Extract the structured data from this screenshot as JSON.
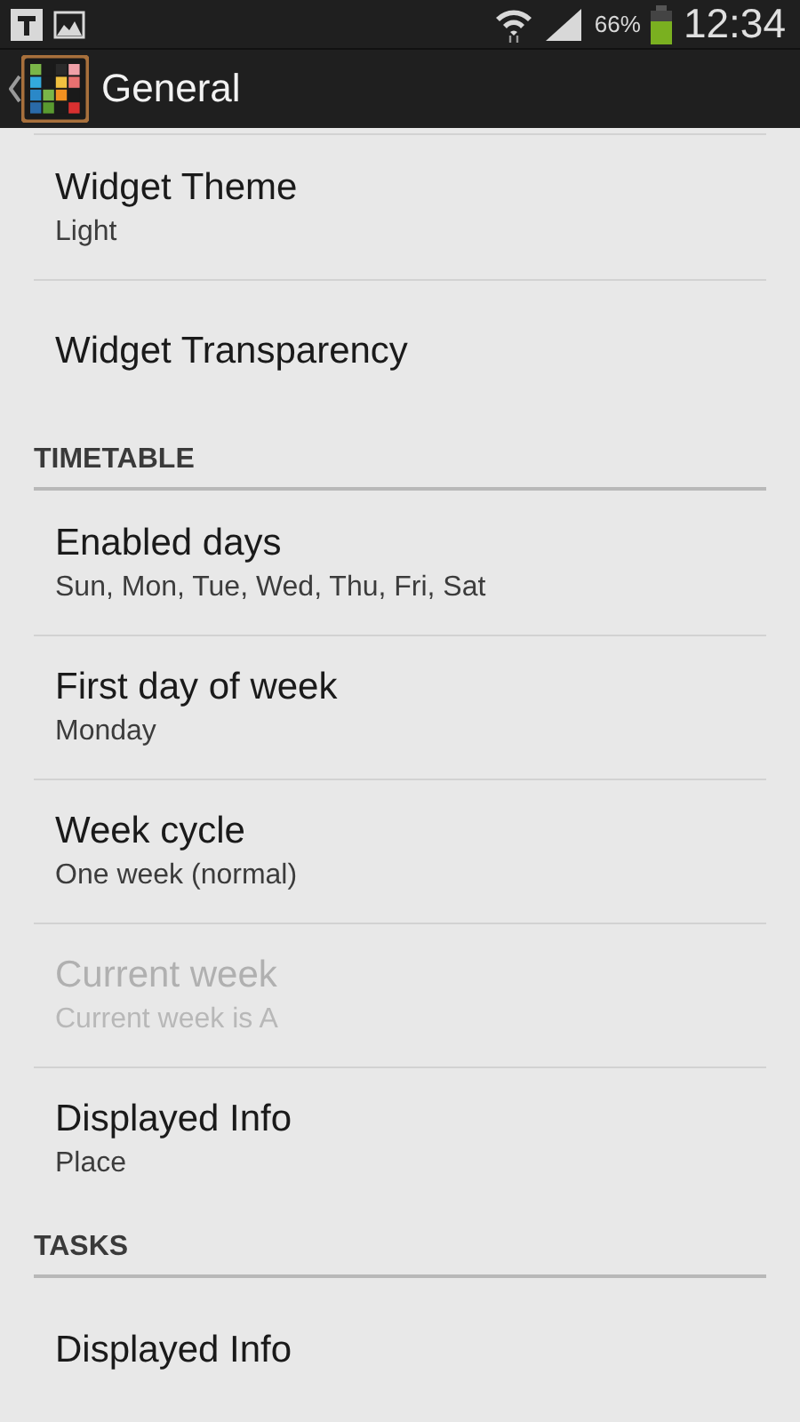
{
  "status_bar": {
    "battery": "66%",
    "time": "12:34"
  },
  "action_bar": {
    "title": "General"
  },
  "sections": [
    {
      "items": [
        {
          "title": "Widget Theme",
          "summary": "Light",
          "disabled": false
        },
        {
          "title": "Widget Transparency",
          "disabled": false
        }
      ]
    },
    {
      "header": "TIMETABLE",
      "items": [
        {
          "title": "Enabled days",
          "summary": "Sun, Mon, Tue, Wed, Thu, Fri, Sat",
          "disabled": false
        },
        {
          "title": "First day of week",
          "summary": "Monday",
          "disabled": false
        },
        {
          "title": "Week cycle",
          "summary": "One week (normal)",
          "disabled": false
        },
        {
          "title": "Current week",
          "summary": "Current week is A",
          "disabled": true
        },
        {
          "title": "Displayed Info",
          "summary": "Place",
          "disabled": false
        }
      ]
    },
    {
      "header": "TASKS",
      "items": [
        {
          "title": "Displayed Info",
          "disabled": false
        }
      ]
    }
  ]
}
